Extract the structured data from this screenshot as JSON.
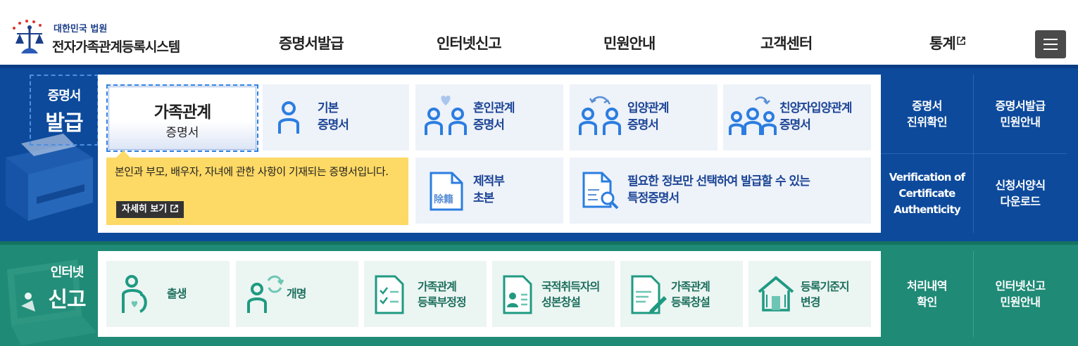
{
  "header": {
    "logo_sub": "대한민국 법원",
    "logo_main": "전자가족관계등록시스템",
    "nav": [
      {
        "label": "증명서발급"
      },
      {
        "label": "인터넷신고"
      },
      {
        "label": "민원안내"
      },
      {
        "label": "고객센터"
      },
      {
        "label": "통계",
        "icon": "external-link-icon"
      }
    ],
    "menu_icon": "hamburger-menu-icon"
  },
  "cert": {
    "title_small": "증명서",
    "title_large": "발급",
    "selected": {
      "title": "가족관계",
      "sub": "증명서"
    },
    "cards": [
      {
        "line1": "기본",
        "line2": "증명서",
        "icon": "person-icon"
      },
      {
        "line1": "혼인관계",
        "line2": "증명서",
        "icon": "couple-heart-icon"
      },
      {
        "line1": "입양관계",
        "line2": "증명서",
        "icon": "adoption-icon"
      },
      {
        "line1": "친양자입양관계",
        "line2": "증명서",
        "icon": "family-adoption-icon"
      },
      {
        "line1": "제적부",
        "line2": "초본",
        "icon": "document-jejeok-icon"
      },
      {
        "line1": "필요한 정보만 선택하여 발급할 수 있는",
        "line2": "특정증명서",
        "icon": "document-search-icon"
      }
    ],
    "tooltip": {
      "text": "본인과 부모, 배우자, 자녀에 관한 사항이 기재되는 증명서입니다.",
      "button": "자세히 보기",
      "button_icon": "external-link-icon"
    },
    "doc_glyph": "除籍",
    "side": [
      {
        "line1": "증명서",
        "line2": "진위확인"
      },
      {
        "line1": "증명서발급",
        "line2": "민원안내"
      },
      {
        "line1": "Verification of",
        "line2": "Certificate",
        "line3": "Authenticity"
      },
      {
        "line1": "신청서양식",
        "line2": "다운로드"
      }
    ]
  },
  "net": {
    "title_small": "인터넷",
    "title_large": "신고",
    "cards": [
      {
        "line1": "출생",
        "line2": "",
        "icon": "birth-icon"
      },
      {
        "line1": "개명",
        "line2": "",
        "icon": "rename-icon"
      },
      {
        "line1": "가족관계",
        "line2": "등록부정정",
        "icon": "checklist-icon"
      },
      {
        "line1": "국적취득자의",
        "line2": "성본창설",
        "icon": "id-card-icon"
      },
      {
        "line1": "가족관계",
        "line2": "등록창설",
        "icon": "document-pen-icon"
      },
      {
        "line1": "등록기준지",
        "line2": "변경",
        "icon": "house-icon"
      }
    ],
    "side": [
      {
        "line1": "처리내역",
        "line2": "확인"
      },
      {
        "line1": "인터넷신고",
        "line2": "민원안내"
      }
    ]
  },
  "colors": {
    "cert_bg": "#0d4a9c",
    "net_bg": "#1f8a76",
    "cert_text": "#1c4596",
    "net_text": "#1d6f5d",
    "tooltip_bg": "#fdd965"
  }
}
